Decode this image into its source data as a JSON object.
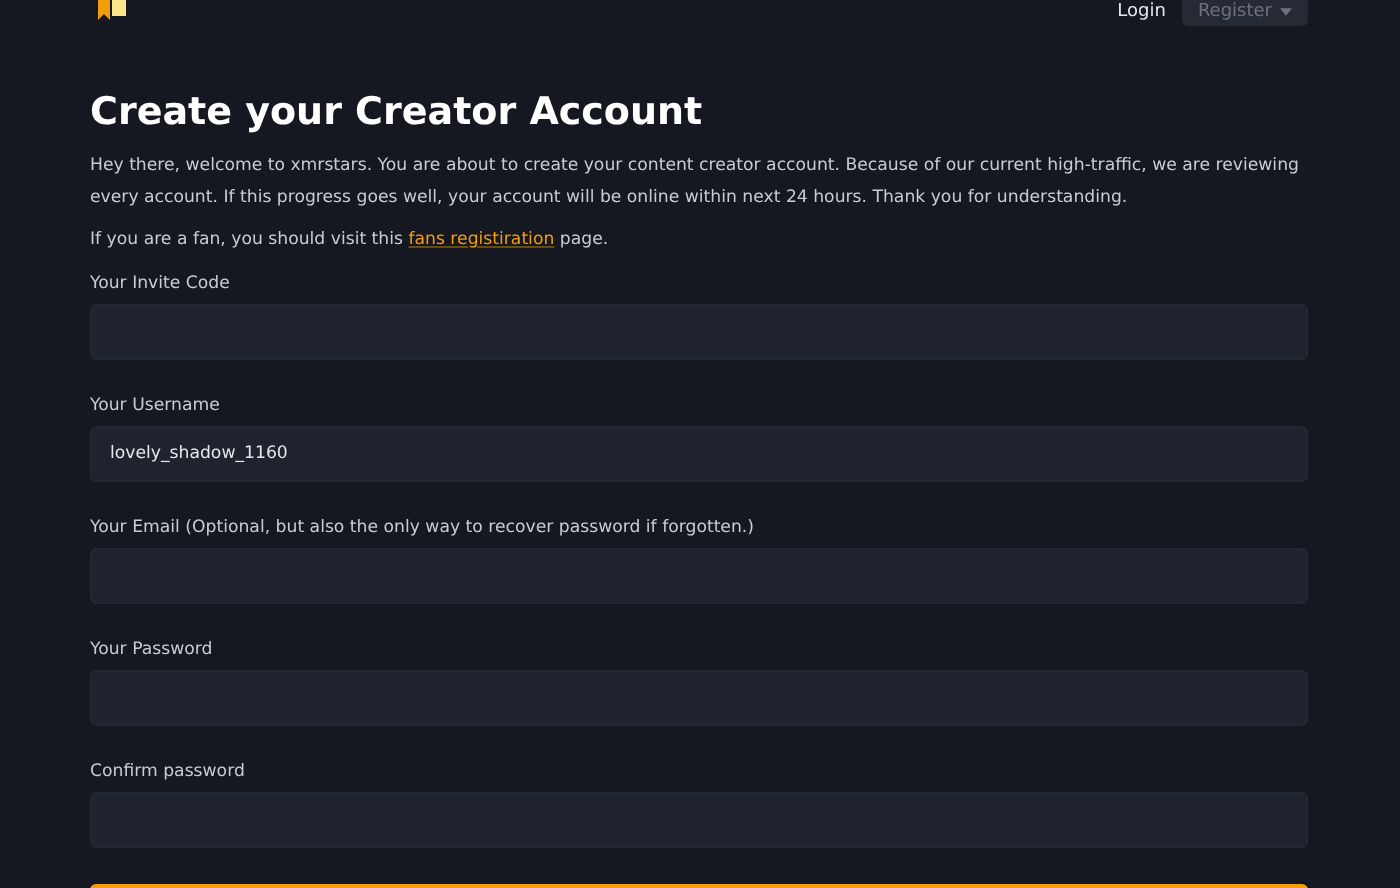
{
  "header": {
    "nav": [
      {
        "label": "Login",
        "kind": "link"
      },
      {
        "label": "Register",
        "kind": "dropdown"
      }
    ]
  },
  "title": "Create your Creator Account",
  "intro": "Hey there, welcome to xmrstars. You are about to create your content creator account. Because of our current high-traffic, we are reviewing every account. If this progress goes well, your account will be online within next 24 hours. Thank you for understanding.",
  "fan_note": {
    "before": "If you are a fan, you should visit this",
    "link": "fans registiration",
    "after": "page."
  },
  "fields": [
    {
      "label": "Your Invite Code"
    },
    {
      "label": "Your Username",
      "value": "lovely_shadow_1160"
    },
    {
      "label": "Your Email (Optional, but also the only way to recover password if forgotten.)"
    },
    {
      "label": "Your Password"
    },
    {
      "label": "Confirm password"
    }
  ]
}
